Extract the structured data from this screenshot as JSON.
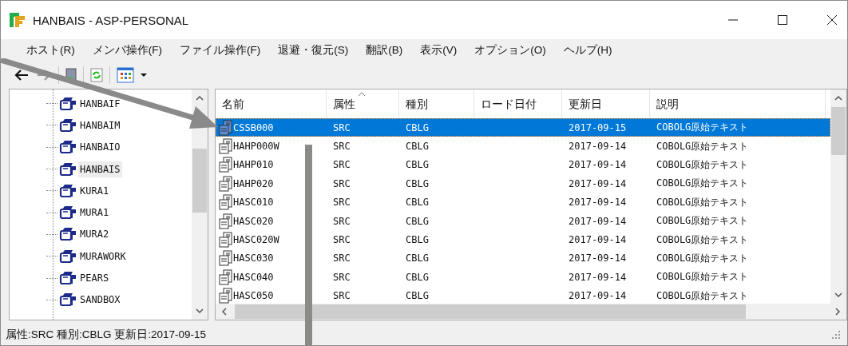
{
  "window": {
    "title": "HANBAIS - ASP-PERSONAL"
  },
  "menu": [
    "ホスト(R)",
    "メンバ操作(F)",
    "ファイル操作(F)",
    "退避・復元(S)",
    "翻訳(B)",
    "表示(V)",
    "オプション(O)",
    "ヘルプ(H)"
  ],
  "tree": [
    {
      "label": "HANBAIF",
      "selected": false
    },
    {
      "label": "HANBAIM",
      "selected": false
    },
    {
      "label": "HANBAIO",
      "selected": false
    },
    {
      "label": "HANBAIS",
      "selected": true
    },
    {
      "label": "KURA1",
      "selected": false
    },
    {
      "label": "MURA1",
      "selected": false
    },
    {
      "label": "MURA2",
      "selected": false
    },
    {
      "label": "MURAWORK",
      "selected": false
    },
    {
      "label": "PEARS",
      "selected": false
    },
    {
      "label": "SANDBOX",
      "selected": false
    }
  ],
  "table": {
    "columns": [
      "名前",
      "属性",
      "種別",
      "ロード日付",
      "更新日",
      "説明"
    ],
    "rows": [
      {
        "cells": [
          "CSSB000",
          "SRC",
          "CBLG",
          "",
          "2017-09-15",
          "COBOLG原始テキスト"
        ],
        "selected": true
      },
      {
        "cells": [
          "HAHP000W",
          "SRC",
          "CBLG",
          "",
          "2017-09-14",
          "COBOLG原始テキスト"
        ],
        "selected": false
      },
      {
        "cells": [
          "HAHP010",
          "SRC",
          "CBLG",
          "",
          "2017-09-14",
          "COBOLG原始テキスト"
        ],
        "selected": false
      },
      {
        "cells": [
          "HAHP020",
          "SRC",
          "CBLG",
          "",
          "2017-09-14",
          "COBOLG原始テキスト"
        ],
        "selected": false
      },
      {
        "cells": [
          "HASC010",
          "SRC",
          "CBLG",
          "",
          "2017-09-14",
          "COBOLG原始テキスト"
        ],
        "selected": false
      },
      {
        "cells": [
          "HASC020",
          "SRC",
          "CBLG",
          "",
          "2017-09-14",
          "COBOLG原始テキスト"
        ],
        "selected": false
      },
      {
        "cells": [
          "HASC020W",
          "SRC",
          "CBLG",
          "",
          "2017-09-14",
          "COBOLG原始テキスト"
        ],
        "selected": false
      },
      {
        "cells": [
          "HASC030",
          "SRC",
          "CBLG",
          "",
          "2017-09-14",
          "COBOLG原始テキスト"
        ],
        "selected": false
      },
      {
        "cells": [
          "HASC040",
          "SRC",
          "CBLG",
          "",
          "2017-09-14",
          "COBOLG原始テキスト"
        ],
        "selected": false
      },
      {
        "cells": [
          "HASC050",
          "SRC",
          "CBLG",
          "",
          "2017-09-14",
          "COBOLG原始テキスト"
        ],
        "selected": false
      }
    ]
  },
  "status_bar": "属性:SRC 種別:CBLG 更新日:2017-09-15"
}
